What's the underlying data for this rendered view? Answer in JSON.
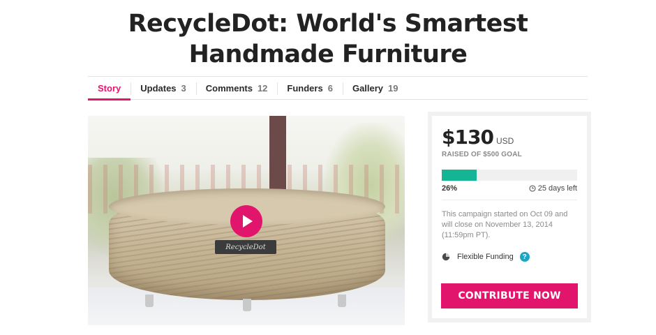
{
  "page": {
    "title_line1": "RecycleDot: World's Smartest",
    "title_line2": "Handmade Furniture"
  },
  "tabs": [
    {
      "label": "Story",
      "count": "",
      "active": true
    },
    {
      "label": "Updates",
      "count": "3"
    },
    {
      "label": "Comments",
      "count": "12"
    },
    {
      "label": "Funders",
      "count": "6"
    },
    {
      "label": "Gallery",
      "count": "19"
    }
  ],
  "video": {
    "badge_text": "RecycleDot",
    "play_icon": "play-icon"
  },
  "funding": {
    "amount": "$130",
    "currency": "USD",
    "goal_text": "RAISED OF $500 GOAL",
    "progress_percent": 26,
    "percent_label": "26%",
    "days_left": "25 days left",
    "note": "This campaign started on Oct 09 and will close on November 13, 2014 (11:59pm PT).",
    "funding_type": "Flexible Funding",
    "help_label": "?",
    "contribute_label": "CONTRIBUTE NOW"
  },
  "colors": {
    "accent": "#e2156d",
    "progress": "#13b595",
    "help": "#1aa6c4"
  }
}
